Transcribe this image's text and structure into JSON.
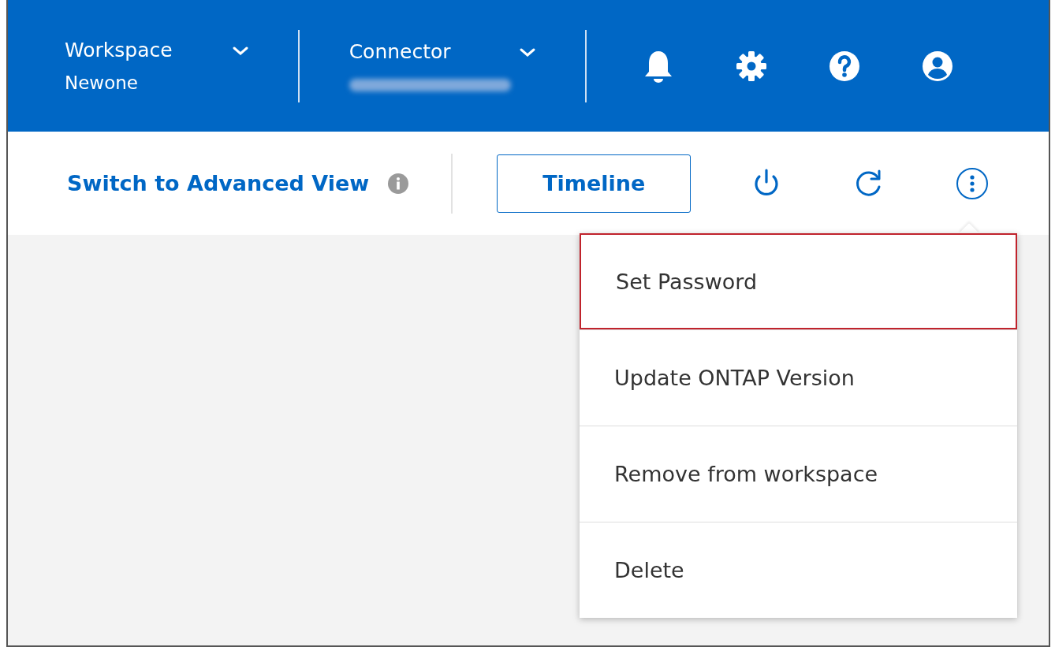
{
  "header": {
    "workspace": {
      "label": "Workspace",
      "value": "Newone"
    },
    "connector": {
      "label": "Connector",
      "value_blurred": true
    }
  },
  "toolbar": {
    "view_link": "Switch to Advanced View",
    "timeline_button": "Timeline"
  },
  "menu": {
    "open": true,
    "items": [
      {
        "label": "Set Password",
        "highlighted": true
      },
      {
        "label": "Update ONTAP Version",
        "highlighted": false
      },
      {
        "label": "Remove from workspace",
        "highlighted": false
      },
      {
        "label": "Delete",
        "highlighted": false
      }
    ]
  }
}
